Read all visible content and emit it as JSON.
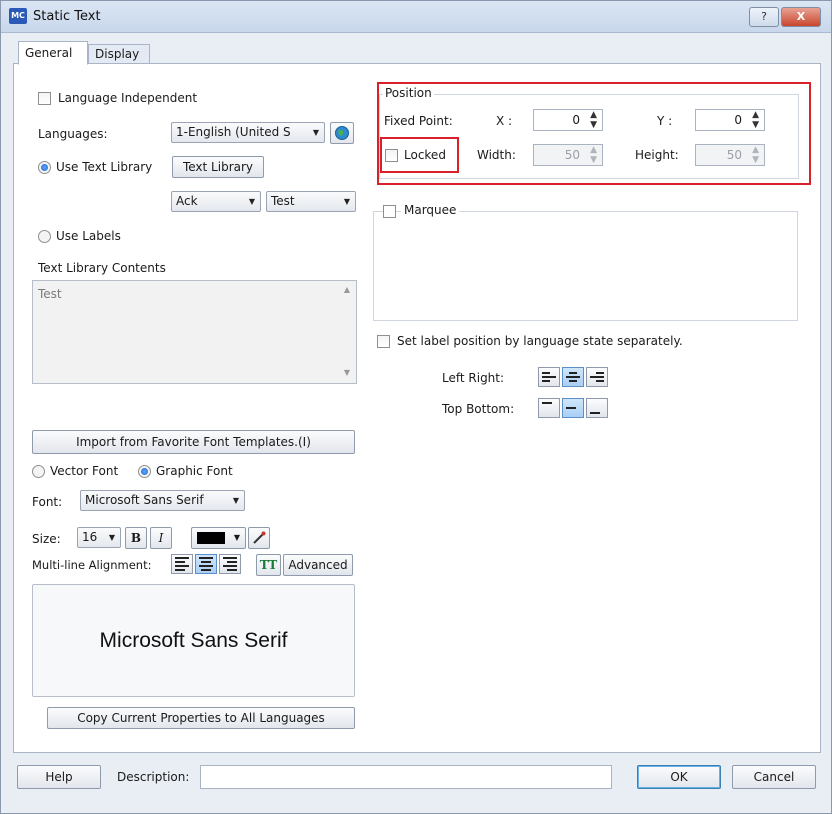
{
  "window": {
    "app_icon": "MC",
    "title": "Static Text",
    "help_glyph": "?",
    "close_glyph": "X"
  },
  "tabs": [
    {
      "label": "General"
    },
    {
      "label": "Display"
    }
  ],
  "general": {
    "language_independent": "Language Independent",
    "languages_label": "Languages:",
    "languages_value": "1-English (United S",
    "use_text_library": "Use Text Library",
    "text_library_button": "Text Library",
    "library_group": "Ack",
    "library_item": "Test",
    "use_labels": "Use Labels",
    "text_library_contents": "Text Library Contents",
    "contents_value": "Test",
    "import_button": "Import from Favorite Font Templates.(I)",
    "vector_font": "Vector Font",
    "graphic_font": "Graphic Font",
    "font_label": "Font:",
    "font_value": "Microsoft Sans Serif",
    "size_label": "Size:",
    "size_value": "16",
    "bold_label": "B",
    "italic_label": "I",
    "multiline_label": "Multi-line Alignment:",
    "advanced_button": "Advanced",
    "tt_label": "TT",
    "preview_text": "Microsoft Sans Serif",
    "copy_button": "Copy Current Properties to All Languages"
  },
  "position": {
    "group_label": "Position",
    "fixed_point": "Fixed Point:",
    "x_label": "X :",
    "x_value": "0",
    "y_label": "Y :",
    "y_value": "0",
    "locked": "Locked",
    "width_label": "Width:",
    "width_value": "50",
    "height_label": "Height:",
    "height_value": "50"
  },
  "marquee": {
    "label": "Marquee"
  },
  "label_position": {
    "set_separately": "Set label position by language  state separately.",
    "left_right": "Left Right:",
    "top_bottom": "Top Bottom:"
  },
  "footer": {
    "help_button": "Help",
    "description_label": "Description:",
    "description_value": "",
    "ok_button": "OK",
    "cancel_button": "Cancel"
  },
  "colors": {
    "highlight": "#d8212b",
    "text_color_swatch": "#000000"
  }
}
